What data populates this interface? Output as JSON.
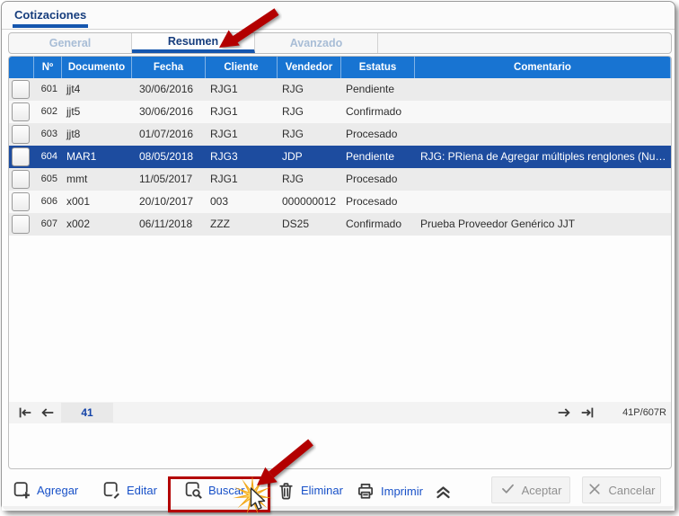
{
  "window": {
    "title": "Cotizaciones"
  },
  "tabs": {
    "items": [
      {
        "label": "General",
        "active": false
      },
      {
        "label": "Resumen",
        "active": true
      },
      {
        "label": "Avanzado",
        "active": false
      }
    ]
  },
  "table": {
    "columns": [
      "",
      "Nº",
      "Documento",
      "Fecha",
      "Cliente",
      "Vendedor",
      "Estatus",
      "Comentario"
    ],
    "rows": [
      {
        "num": "601",
        "documento": "jjt4",
        "fecha": "30/06/2016",
        "cliente": "RJG1",
        "vendedor": "RJG",
        "estatus": "Pendiente",
        "comentario": "",
        "selected": false
      },
      {
        "num": "602",
        "documento": "jjt5",
        "fecha": "30/06/2016",
        "cliente": "RJG1",
        "vendedor": "RJG",
        "estatus": "Confirmado",
        "comentario": "",
        "selected": false
      },
      {
        "num": "603",
        "documento": "jjt8",
        "fecha": "01/07/2016",
        "cliente": "RJG1",
        "vendedor": "RJG",
        "estatus": "Procesado",
        "comentario": "",
        "selected": false
      },
      {
        "num": "604",
        "documento": "MAR1",
        "fecha": "08/05/2018",
        "cliente": "RJG3",
        "vendedor": "JDP",
        "estatus": "Pendiente",
        "comentario": "RJG: PRiena de Agregar múltiples renglones (Nue...",
        "selected": true
      },
      {
        "num": "605",
        "documento": "mmt",
        "fecha": "11/05/2017",
        "cliente": "RJG1",
        "vendedor": "RJG",
        "estatus": "Procesado",
        "comentario": "",
        "selected": false
      },
      {
        "num": "606",
        "documento": "x001",
        "fecha": "20/10/2017",
        "cliente": "003",
        "vendedor": "000000012",
        "estatus": "Procesado",
        "comentario": "",
        "selected": false
      },
      {
        "num": "607",
        "documento": "x002",
        "fecha": "06/11/2018",
        "cliente": "ZZZ",
        "vendedor": "DS25",
        "estatus": "Confirmado",
        "comentario": "Prueba Proveedor Genérico JJT",
        "selected": false
      }
    ]
  },
  "pagination": {
    "current_page": "41",
    "record_info": "41P/607R",
    "icons": {
      "first": "arrow-bar-left-icon",
      "prev": "arrow-left-icon",
      "next": "arrow-right-icon",
      "last": "arrow-bar-right-icon"
    }
  },
  "toolbar": {
    "agregar_label": "Agregar",
    "editar_label": "Editar",
    "buscar_label": "Buscar",
    "eliminar_label": "Eliminar",
    "imprimir_label": "Imprimir",
    "aceptar_label": "Aceptar",
    "cancelar_label": "Cancelar",
    "icons": {
      "agregar": "square-plus-icon",
      "editar": "square-pencil-icon",
      "buscar": "square-magnifier-icon",
      "eliminar": "trash-icon",
      "imprimir": "printer-icon",
      "collapse": "double-chevron-up-icon",
      "aceptar": "check-icon",
      "cancelar": "x-icon"
    }
  },
  "annotations": {
    "arrow_1_target": "tab Resumen",
    "arrow_2_target": "Buscar button",
    "highlight_box_target": "Buscar button",
    "click_effect": "starburst + mouse cursor on Buscar"
  },
  "colors": {
    "header_blue": "#1874D2",
    "selected_row_blue": "#1D4C9F",
    "accent_blue": "#1556AE",
    "link_blue": "#1851C8",
    "active_tab_text": "#163D7D",
    "inactive_tab_text": "#A8BDD6",
    "annotation_red": "#B30000",
    "starburst_yellow": "#F2A71B"
  }
}
